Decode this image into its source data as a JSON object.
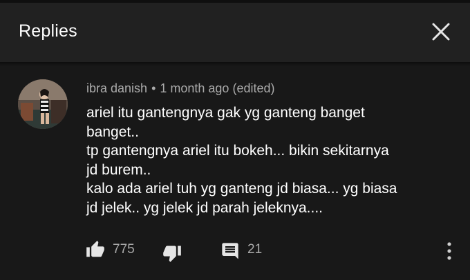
{
  "header": {
    "title": "Replies",
    "close_icon": "close-icon"
  },
  "comment": {
    "author": "ibra danish",
    "separator": "•",
    "timestamp": "1 month ago (edited)",
    "text": "ariel itu gantengnya gak yg ganteng banget\nbanget..\ntp gantengnya ariel itu bokeh... bikin sekitarnya\njd burem..\nkalo ada ariel tuh yg ganteng jd biasa... yg biasa\njd jelek.. yg jelek jd parah jeleknya....",
    "likes": "775",
    "replies": "21",
    "icons": {
      "like": "thumbs-up-icon",
      "dislike": "thumbs-down-icon",
      "reply": "comment-icon",
      "more": "more-vertical-icon"
    }
  }
}
